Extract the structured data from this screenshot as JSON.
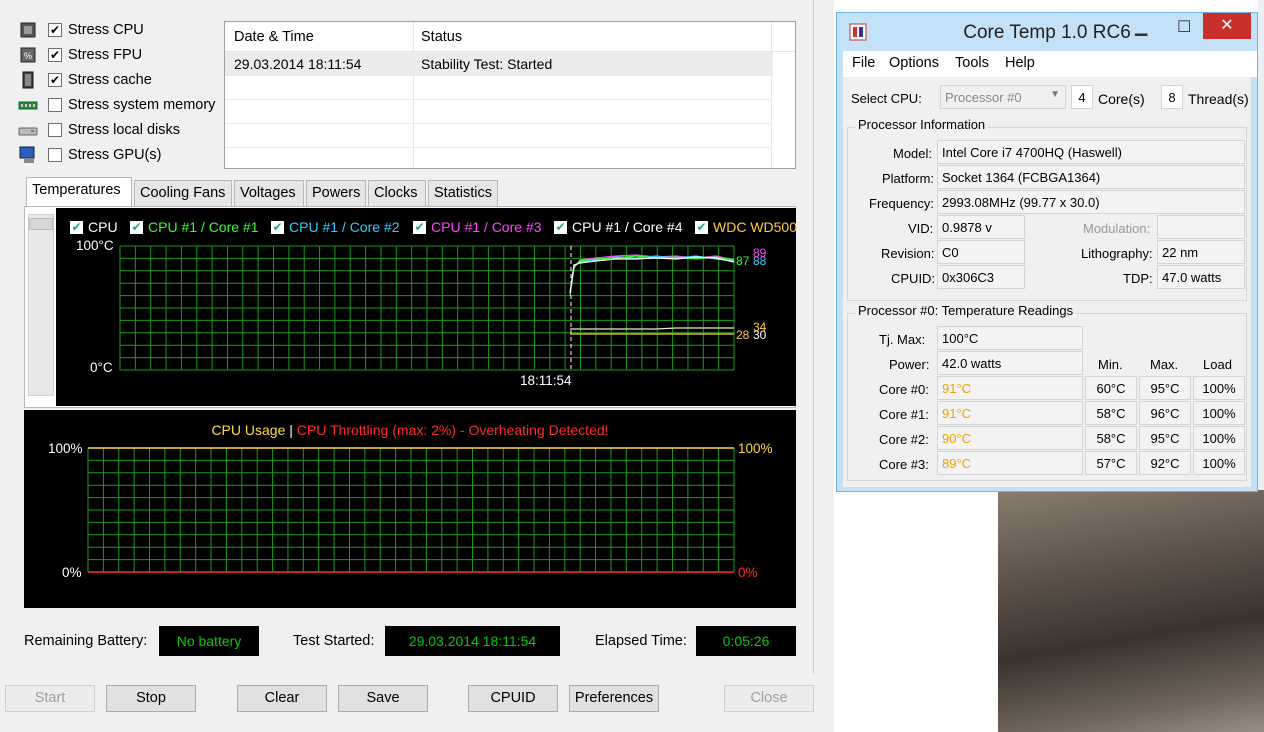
{
  "aida": {
    "stress_items": [
      {
        "label": "Stress CPU",
        "checked": true,
        "icon": "cpu-icon"
      },
      {
        "label": "Stress FPU",
        "checked": true,
        "icon": "fpu-icon"
      },
      {
        "label": "Stress cache",
        "checked": true,
        "icon": "cache-icon"
      },
      {
        "label": "Stress system memory",
        "checked": false,
        "icon": "memory-icon"
      },
      {
        "label": "Stress local disks",
        "checked": false,
        "icon": "disk-icon"
      },
      {
        "label": "Stress GPU(s)",
        "checked": false,
        "icon": "gpu-icon"
      }
    ],
    "log": {
      "col_datetime": "Date & Time",
      "col_status": "Status",
      "rows": [
        {
          "datetime": "29.03.2014 18:11:54",
          "status": "Stability Test: Started"
        }
      ]
    },
    "tabs": [
      "Temperatures",
      "Cooling Fans",
      "Voltages",
      "Powers",
      "Clocks",
      "Statistics"
    ],
    "temp_graph": {
      "legend": [
        {
          "label": "CPU",
          "color": "#ffffff"
        },
        {
          "label": "CPU #1 / Core #1",
          "color": "#33ff33"
        },
        {
          "label": "CPU #1 / Core #2",
          "color": "#33ccff"
        },
        {
          "label": "CPU #1 / Core #3",
          "color": "#ff44ff"
        },
        {
          "label": "CPU #1 / Core #4",
          "color": "#ffffff"
        },
        {
          "label": "WDC WD500",
          "color": "#ffcc33"
        }
      ],
      "y_top": "100°C",
      "y_bottom": "0°C",
      "time_label": "18:11:54",
      "right_high_values": [
        "87",
        "88",
        "89"
      ],
      "right_low_values": [
        "28",
        "30",
        "34"
      ]
    },
    "cpu_graph": {
      "title_usage": "CPU Usage",
      "separator": "|",
      "title_throttle": "CPU Throttling (max: 2%) - Overheating Detected!",
      "y_top_left": "100%",
      "y_bottom_left": "0%",
      "y_top_right": "100%",
      "y_bottom_right": "0%"
    },
    "status": {
      "battery_label": "Remaining Battery:",
      "battery_value": "No battery",
      "started_label": "Test Started:",
      "started_value": "29.03.2014 18:11:54",
      "elapsed_label": "Elapsed Time:",
      "elapsed_value": "0:05:26"
    },
    "buttons": {
      "start": "Start",
      "stop": "Stop",
      "clear": "Clear",
      "save": "Save",
      "cpuid": "CPUID",
      "preferences": "Preferences",
      "close": "Close"
    }
  },
  "coretemp": {
    "title": "Core Temp 1.0 RC6",
    "menu": [
      "File",
      "Options",
      "Tools",
      "Help"
    ],
    "select_cpu_label": "Select CPU:",
    "select_cpu_value": "Processor #0",
    "cores_count": "4",
    "cores_label": "Core(s)",
    "threads_count": "8",
    "threads_label": "Thread(s)",
    "proc_info_title": "Processor Information",
    "info": {
      "model_label": "Model:",
      "model": "Intel Core i7 4700HQ (Haswell)",
      "platform_label": "Platform:",
      "platform": "Socket 1364 (FCBGA1364)",
      "frequency_label": "Frequency:",
      "frequency": "2993.08MHz (99.77 x 30.0)",
      "vid_label": "VID:",
      "vid": "0.9878 v",
      "modulation_label": "Modulation:",
      "modulation": "",
      "revision_label": "Revision:",
      "revision": "C0",
      "lithography_label": "Lithography:",
      "lithography": "22 nm",
      "cpuid_label": "CPUID:",
      "cpuid": "0x306C3",
      "tdp_label": "TDP:",
      "tdp": "47.0 watts"
    },
    "temps_title": "Processor #0: Temperature Readings",
    "tjmax_label": "Tj. Max:",
    "tjmax": "100°C",
    "power_label": "Power:",
    "power": "42.0 watts",
    "col_min": "Min.",
    "col_max": "Max.",
    "col_load": "Load",
    "cores": [
      {
        "label": "Core #0:",
        "temp": "91°C",
        "min": "60°C",
        "max": "95°C",
        "load": "100%"
      },
      {
        "label": "Core #1:",
        "temp": "91°C",
        "min": "58°C",
        "max": "96°C",
        "load": "100%"
      },
      {
        "label": "Core #2:",
        "temp": "90°C",
        "min": "58°C",
        "max": "95°C",
        "load": "100%"
      },
      {
        "label": "Core #3:",
        "temp": "89°C",
        "min": "57°C",
        "max": "92°C",
        "load": "100%"
      }
    ]
  }
}
